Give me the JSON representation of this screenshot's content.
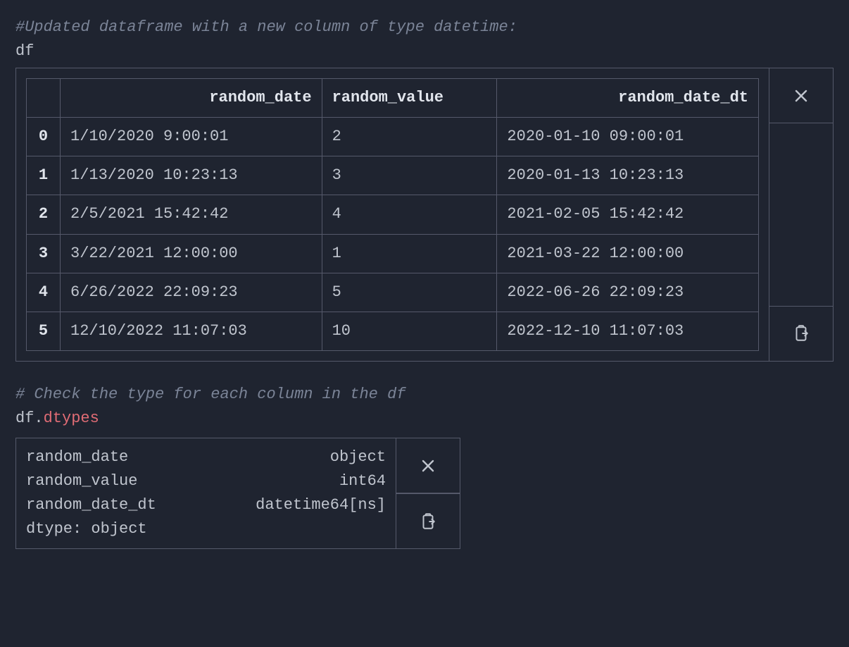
{
  "cell1": {
    "comment": "#Updated dataframe with a new column of type datetime:",
    "code": "df",
    "table": {
      "headers": [
        "",
        "random_date",
        "random_value",
        "random_date_dt"
      ],
      "rows": [
        {
          "idx": "0",
          "random_date": "1/10/2020 9:00:01",
          "random_value": "2",
          "random_date_dt": "2020-01-10 09:00:01"
        },
        {
          "idx": "1",
          "random_date": "1/13/2020 10:23:13",
          "random_value": "3",
          "random_date_dt": "2020-01-13 10:23:13"
        },
        {
          "idx": "2",
          "random_date": "2/5/2021 15:42:42",
          "random_value": "4",
          "random_date_dt": "2021-02-05 15:42:42"
        },
        {
          "idx": "3",
          "random_date": "3/22/2021 12:00:00",
          "random_value": "1",
          "random_date_dt": "2021-03-22 12:00:00"
        },
        {
          "idx": "4",
          "random_date": "6/26/2022 22:09:23",
          "random_value": "5",
          "random_date_dt": "2022-06-26 22:09:23"
        },
        {
          "idx": "5",
          "random_date": "12/10/2022 11:07:03",
          "random_value": "10",
          "random_date_dt": "2022-12-10 11:07:03"
        }
      ]
    }
  },
  "cell2": {
    "comment": "# Check the type for each column in the df",
    "code_prefix": "df.",
    "code_attr": "dtypes",
    "dtypes": {
      "rows": [
        {
          "name": "random_date",
          "type": "object"
        },
        {
          "name": "random_value",
          "type": "int64"
        },
        {
          "name": "random_date_dt",
          "type": "datetime64[ns]"
        }
      ],
      "summary": "dtype: object"
    }
  },
  "icons": {
    "close": "close-icon",
    "copy": "clipboard-copy-icon"
  }
}
